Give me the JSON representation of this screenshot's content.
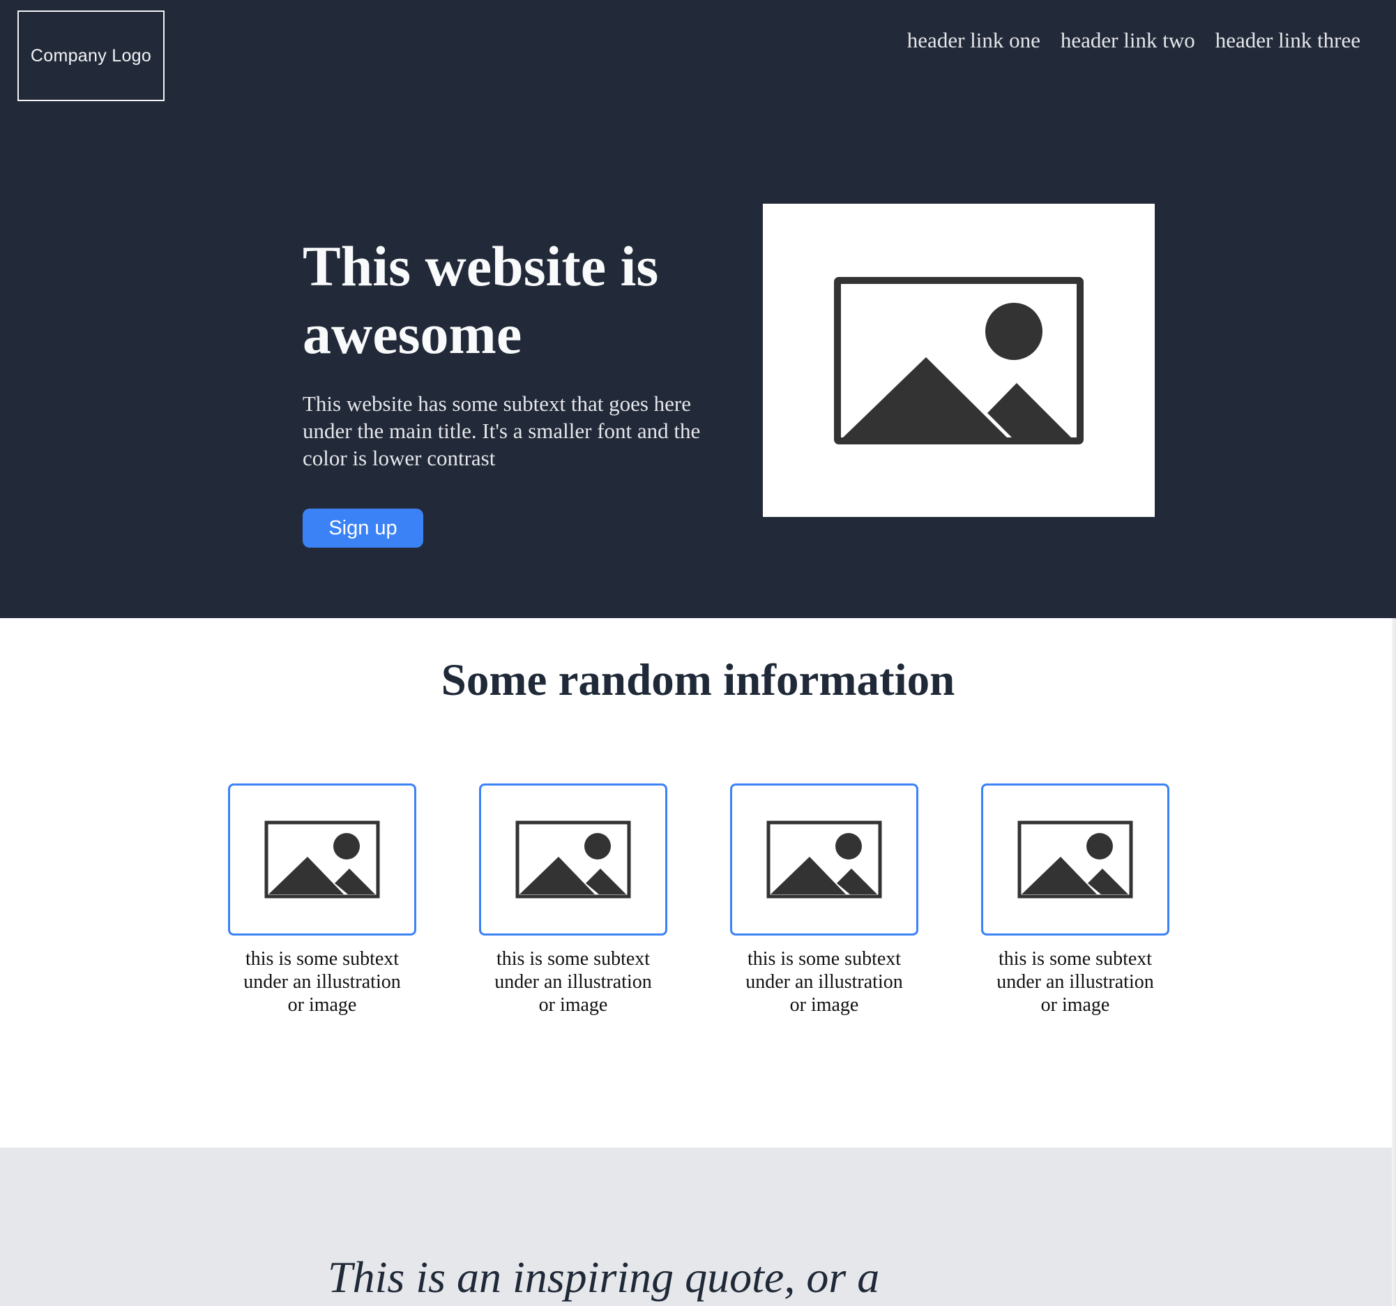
{
  "header": {
    "logo_text": "Company Logo",
    "links": [
      "header link one",
      "header link two",
      "header link three"
    ]
  },
  "hero": {
    "title": "This website is awesome",
    "subtext": "This website has some subtext that goes here under the main title. It's a smaller font and the color is lower contrast",
    "cta_label": "Sign up",
    "image_icon": "image-placeholder-icon"
  },
  "info": {
    "title": "Some random information",
    "cards": [
      {
        "icon": "image-placeholder-icon",
        "text": "this is some subtext under an illustration or image"
      },
      {
        "icon": "image-placeholder-icon",
        "text": "this is some subtext under an illustration or image"
      },
      {
        "icon": "image-placeholder-icon",
        "text": "this is some subtext under an illustration or image"
      },
      {
        "icon": "image-placeholder-icon",
        "text": "this is some subtext under an illustration or image"
      }
    ]
  },
  "quote": {
    "text": "This is an inspiring quote, or a"
  },
  "colors": {
    "header_bg": "#222938",
    "accent": "#3b82f6",
    "quote_bg": "#e5e7eb",
    "icon": "#333333"
  }
}
